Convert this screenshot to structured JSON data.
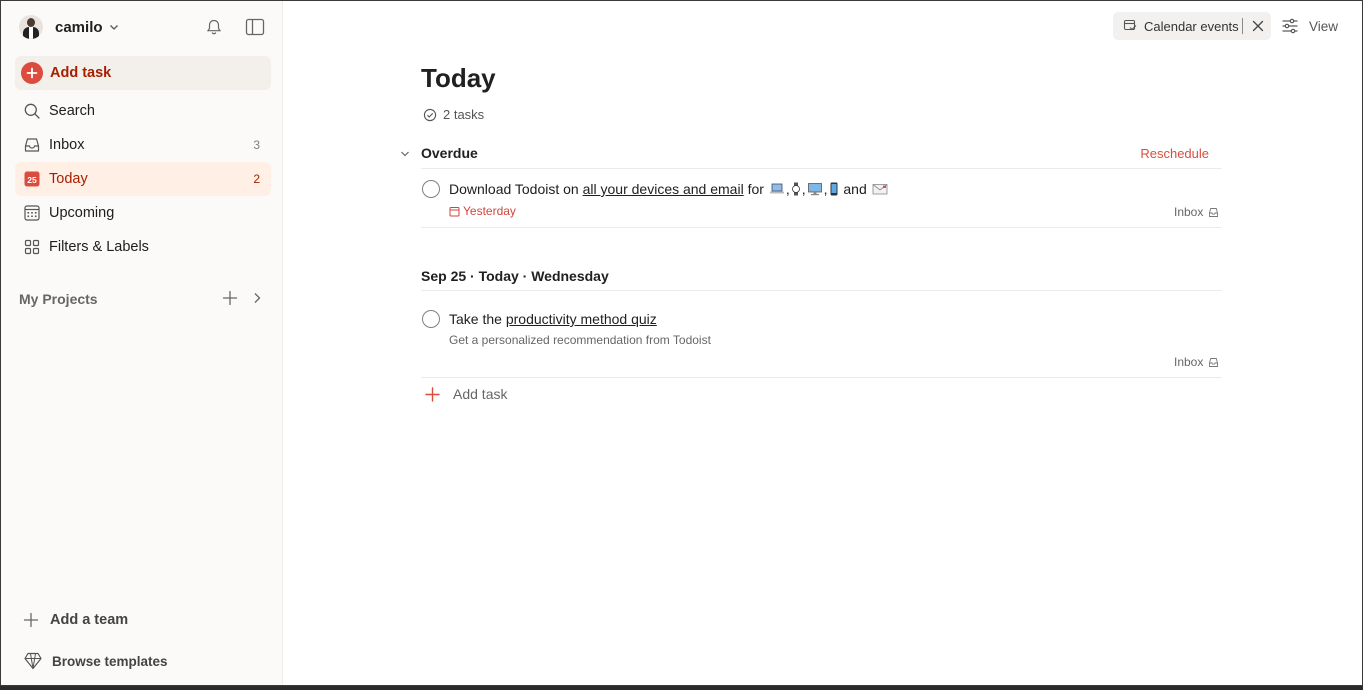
{
  "sidebar": {
    "username": "camilo",
    "add_task_label": "Add task",
    "items": [
      {
        "label": "Search",
        "count": "",
        "icon": "search-icon"
      },
      {
        "label": "Inbox",
        "count": "3",
        "icon": "inbox-icon"
      },
      {
        "label": "Today",
        "count": "2",
        "icon": "today-calendar-icon",
        "active": true,
        "day_number": "25"
      },
      {
        "label": "Upcoming",
        "count": "",
        "icon": "upcoming-calendar-icon"
      },
      {
        "label": "Filters & Labels",
        "count": "",
        "icon": "filters-grid-icon"
      }
    ],
    "my_projects_label": "My Projects",
    "add_team_label": "Add a team",
    "browse_templates_label": "Browse templates"
  },
  "toolbar": {
    "calendar_events_label": "Calendar events",
    "view_label": "View"
  },
  "main": {
    "title": "Today",
    "task_count": "2 tasks",
    "overdue": {
      "label": "Overdue",
      "reschedule_label": "Reschedule",
      "task": {
        "prefix": "Download Todoist on ",
        "link": "all your devices and email",
        "suffix_for": " for ",
        "and": " and ",
        "due": "Yesterday",
        "project": "Inbox"
      }
    },
    "today_section": {
      "label": "Sep 25 · Today · Wednesday",
      "task": {
        "prefix": "Take the ",
        "link": "productivity method quiz",
        "description": "Get a personalized recommendation from Todoist",
        "project": "Inbox"
      }
    },
    "add_task_label": "Add task"
  },
  "colors": {
    "accent": "#dc4c3e",
    "active_bg": "#ffefe5",
    "active_text": "#a81f00",
    "sidebar_bg": "#fcfaf8"
  }
}
